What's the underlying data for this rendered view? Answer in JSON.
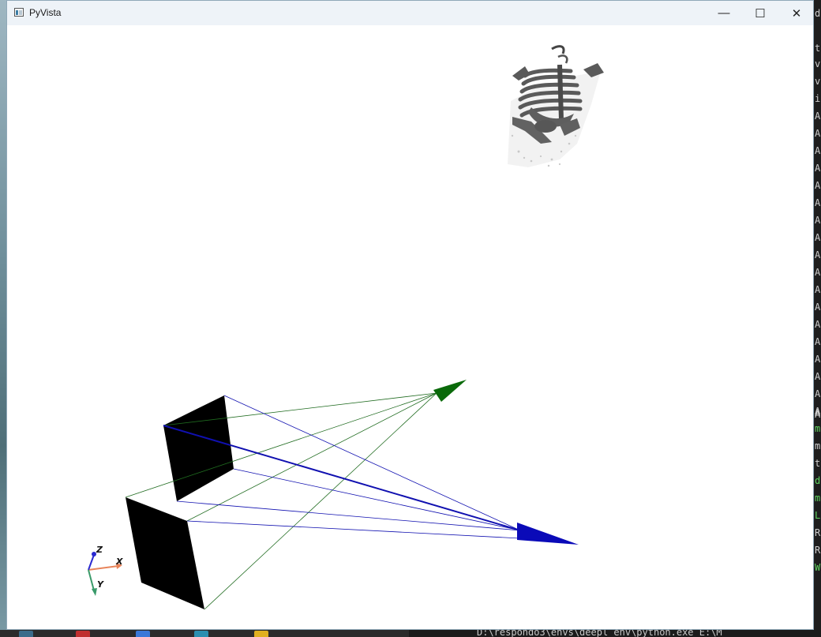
{
  "window": {
    "title": "PyVista",
    "minimize_glyph": "—",
    "maximize_glyph": "☐",
    "close_glyph": "✕"
  },
  "scene": {
    "objects": [
      "skeleton-volume-render",
      "camera-frustum-green",
      "camera-frustum-blue",
      "image-plane-near",
      "image-plane-far"
    ],
    "colors": {
      "background": "#ffffff",
      "frustum_green": "#1f6b1f",
      "frustum_blue": "#1010b0",
      "image_plane": "#000000",
      "skeleton": "#5f5f5f"
    }
  },
  "orientation_axes": {
    "x_label": "X",
    "y_label": "Y",
    "z_label": "Z",
    "colors": {
      "x": "#e8845a",
      "y": "#3a9a6a",
      "z": "#2a2ad0"
    }
  },
  "background_terminal": {
    "line_chars": [
      "d",
      "te",
      "vE",
      "vs",
      "il",
      "A",
      "A",
      "A",
      "A",
      "A",
      "A",
      "A",
      "A",
      "A",
      "A",
      "A",
      "A",
      "A",
      "A",
      "A",
      "A",
      "A",
      "A",
      "A",
      "A",
      "m",
      "m",
      "th",
      "do",
      "m",
      "LC",
      "RE",
      "RE",
      "W"
    ],
    "bottom_text": "D:\\respondo3\\envs\\deepl_env\\python.exe E:\\M"
  }
}
